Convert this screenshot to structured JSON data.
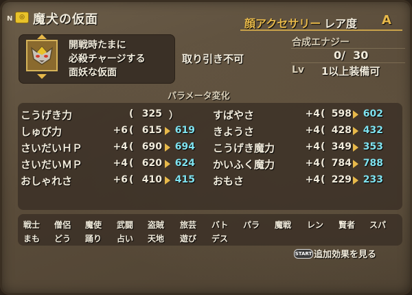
{
  "header": {
    "n_badge": "N",
    "item_name": "魔犬の仮面",
    "category": "顔アクセサリー",
    "rarity_label": "レア度",
    "rarity_value": "A"
  },
  "description": [
    "開戦時たまに",
    "必殺チャージする",
    "面妖な仮面"
  ],
  "trade": "取り引き不可",
  "synthesis": {
    "label": "合成エナジー",
    "value": "0/  30"
  },
  "level": {
    "label": "Lv",
    "value": "1以上装備可"
  },
  "param_title": "パラメータ変化",
  "stats_left": [
    {
      "name": "こうげき力",
      "bonus": "",
      "base": "325",
      "new": ""
    },
    {
      "name": "しゅび力",
      "bonus": "+6",
      "base": "615",
      "new": "619"
    },
    {
      "name": "さいだいＨＰ",
      "bonus": "+4",
      "base": "690",
      "new": "694"
    },
    {
      "name": "さいだいＭＰ",
      "bonus": "+4",
      "base": "620",
      "new": "624"
    },
    {
      "name": "おしゃれさ",
      "bonus": "+6",
      "base": "410",
      "new": "415"
    }
  ],
  "stats_right": [
    {
      "name": "すばやさ",
      "bonus": "+4",
      "base": "598",
      "new": "602"
    },
    {
      "name": "きようさ",
      "bonus": "+4",
      "base": "428",
      "new": "432"
    },
    {
      "name": "こうげき魔力",
      "bonus": "+4",
      "base": "349",
      "new": "353"
    },
    {
      "name": "かいふく魔力",
      "bonus": "+4",
      "base": "784",
      "new": "788"
    },
    {
      "name": "おもさ",
      "bonus": "+4",
      "base": "229",
      "new": "233"
    }
  ],
  "jobs_row1": [
    "戦士",
    "僧侶",
    "魔使",
    "武闘",
    "盗賊",
    "旅芸",
    "バト",
    "パラ",
    "魔戦",
    "レン",
    "賢者",
    "スパ"
  ],
  "jobs_row2": [
    "まも",
    "どう",
    "踊り",
    "占い",
    "天地",
    "遊び",
    "デス"
  ],
  "start": {
    "key": "START",
    "label": "追加効果を見る"
  },
  "icons": {
    "item": "item-bag-icon",
    "mask": "demon-dog-mask-icon"
  },
  "colors": {
    "accent": "#e8b94a",
    "new_value": "#7fe3f0",
    "text": "#f2ecdc"
  }
}
